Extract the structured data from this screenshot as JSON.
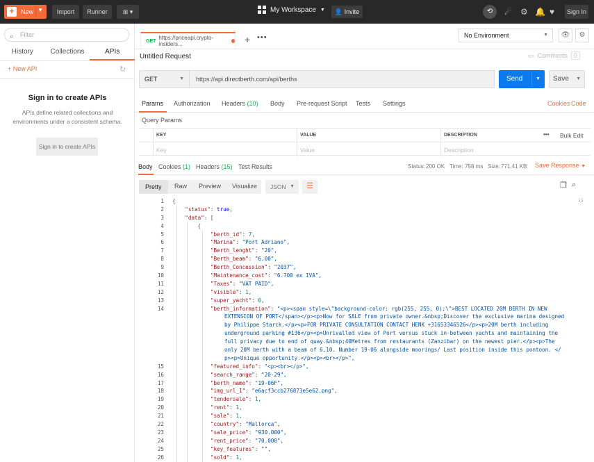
{
  "topbar": {
    "new_label": "New",
    "import_label": "Import",
    "runner_label": "Runner",
    "workspace": "My Workspace",
    "invite": "Invite",
    "sign_in": "Sign In"
  },
  "sidebar": {
    "filter_placeholder": "Filter",
    "tabs": [
      {
        "label": "History"
      },
      {
        "label": "Collections"
      },
      {
        "label": "APIs"
      }
    ],
    "new_api": "+ New API",
    "title": "Sign in to create APIs",
    "description": "APIs define related collections and environments under a consistent schema.",
    "button": "Sign in to create APIs"
  },
  "tab": {
    "method": "GET",
    "title": "https://priceapi.crypto-insiders..."
  },
  "environment": "No Environment",
  "request": {
    "name": "Untitled Request",
    "comments": "Comments",
    "comments_count": "0",
    "method": "GET",
    "url": "https://api.directberth.com/api/berths",
    "send": "Send",
    "save": "Save"
  },
  "req_tabs": {
    "params": "Params",
    "authorization": "Authorization",
    "headers": "Headers",
    "headers_count": "(10)",
    "body": "Body",
    "prerequest": "Pre-request Script",
    "tests": "Tests",
    "settings": "Settings",
    "cookies": "Cookies",
    "code": "Code"
  },
  "params": {
    "title": "Query Params",
    "key_h": "KEY",
    "value_h": "VALUE",
    "desc_h": "DESCRIPTION",
    "more": "•••",
    "bulk": "Bulk Edit",
    "key_ph": "Key",
    "value_ph": "Value",
    "desc_ph": "Description"
  },
  "resp_tabs": {
    "body": "Body",
    "cookies": "Cookies",
    "cookies_count": "(1)",
    "headers": "Headers",
    "headers_count": "(15)",
    "test_results": "Test Results"
  },
  "status": {
    "status_label": "Status:",
    "status_value": "200 OK",
    "time_label": "Time:",
    "time_value": "758 ms",
    "size_label": "Size:",
    "size_value": "771.41 KB",
    "save_response": "Save Response"
  },
  "view": {
    "pretty": "Pretty",
    "raw": "Raw",
    "preview": "Preview",
    "visualize": "Visualize",
    "format": "JSON"
  },
  "code": {
    "lines": [
      {
        "n": "1",
        "text": "{"
      },
      {
        "n": "2",
        "text": "    \"status\": true,"
      },
      {
        "n": "3",
        "text": "    \"data\": ["
      },
      {
        "n": "4",
        "text": "        {"
      },
      {
        "n": "5",
        "text": "            \"berth_id\": 7,"
      },
      {
        "n": "6",
        "text": "            \"Marina\": \"Port Adriano\","
      },
      {
        "n": "7",
        "text": "            \"Berth_lenght\": \"20\","
      },
      {
        "n": "8",
        "text": "            \"Berth_beam\": \"6,00\","
      },
      {
        "n": "9",
        "text": "            \"Berth_Concession\": \"2037\","
      },
      {
        "n": "10",
        "text": "            \"Maintenance_cost\": \"6.700 ex IVA\","
      },
      {
        "n": "11",
        "text": "            \"Taxes\": \"VAT PAID\","
      },
      {
        "n": "12",
        "text": "            \"visible\": 1,"
      },
      {
        "n": "13",
        "text": "            \"super_yacht\": 0,"
      },
      {
        "n": "14",
        "text": "            \"berth_information\": \"<p><span style=\\\"background-color: rgb(255, 255, 0);\\\">BEST LOCATED 20M BERTH IN NEW"
      },
      {
        "n": "",
        "text": "EXTENSION OF PORT</span></p><p>Now for SALE from private owner.&nbsp;Discover the exclusive marina designed"
      },
      {
        "n": "",
        "text": "by Philippe Starck.</p><p>FOR PRIVATE CONSULTATION CONTACT HENK +31653346526</p><p>20M berth including"
      },
      {
        "n": "",
        "text": "underground parking #136</p><p>Unrivalled view of Port versus stuck in-between yachts and maintaining the"
      },
      {
        "n": "",
        "text": "full privacy due to end of quay.&nbsp;40Metres from restaurants (Zanzibar) on the newest pier.</p><p>The"
      },
      {
        "n": "",
        "text": "only 20M berth with a beam of 6,10. Number 19-06 alongside moorings/ Last position inside this pontoon. </"
      },
      {
        "n": "",
        "text": "p><p>Unique opportunity.</p><p><br></p>\","
      },
      {
        "n": "15",
        "text": "            \"featured_info\": \"<p><br></p>\","
      },
      {
        "n": "16",
        "text": "            \"search_range\": \"20-29\","
      },
      {
        "n": "17",
        "text": "            \"berth_name\": \"19-06F\","
      },
      {
        "n": "18",
        "text": "            \"img_url_1\": \"e6acf3ccb276873e5e62.png\","
      },
      {
        "n": "19",
        "text": "            \"tendersale\": 1,"
      },
      {
        "n": "20",
        "text": "            \"rent\": 1,"
      },
      {
        "n": "21",
        "text": "            \"sale\": 1,"
      },
      {
        "n": "22",
        "text": "            \"country\": \"Mallorca\","
      },
      {
        "n": "23",
        "text": "            \"sale_price\": \"930.000\","
      },
      {
        "n": "24",
        "text": "            \"rent_price\": \"70.000\","
      },
      {
        "n": "25",
        "text": "            \"key_features\": \"\","
      },
      {
        "n": "26",
        "text": "            \"sold\": 1,"
      }
    ]
  }
}
